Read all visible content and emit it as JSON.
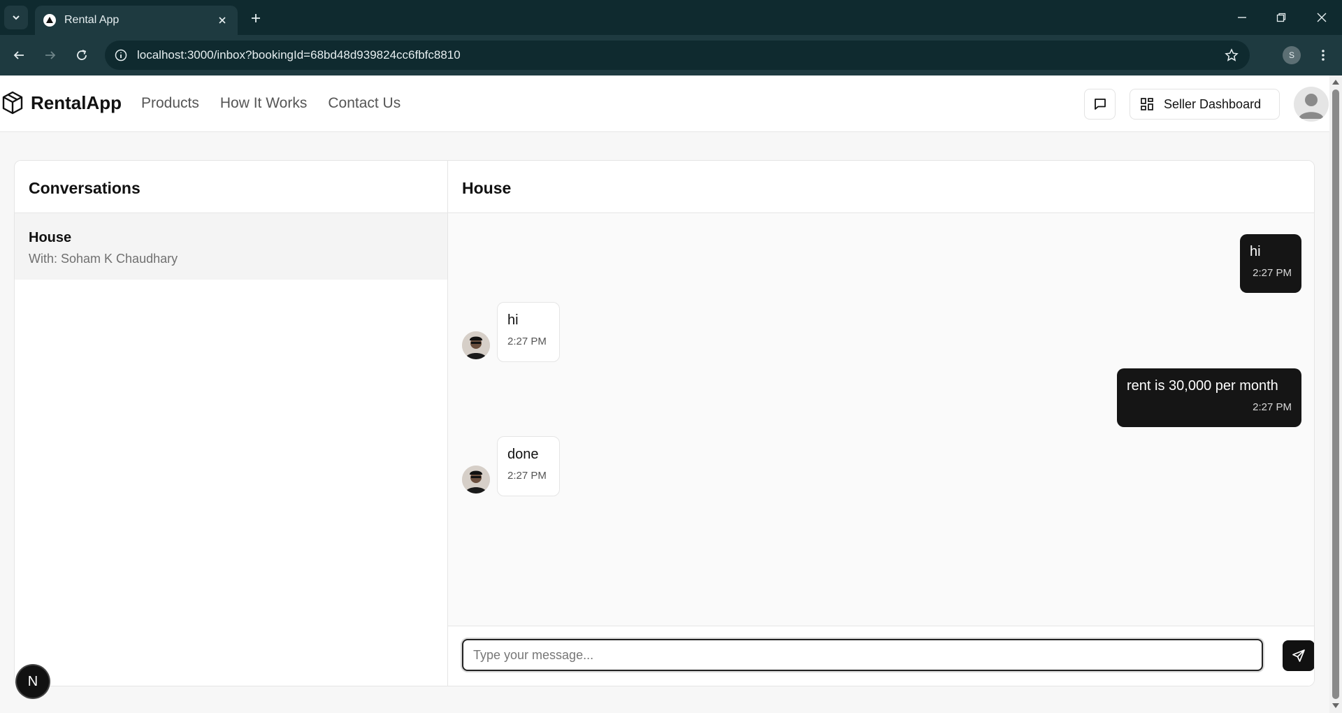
{
  "browser": {
    "tab_title": "Rental App",
    "url": "localhost:3000/inbox?bookingId=68bd48d939824cc6fbfc8810",
    "profile_initial": "S"
  },
  "header": {
    "brand": "RentalApp",
    "nav": [
      "Products",
      "How It Works",
      "Contact Us"
    ],
    "seller_dashboard_label": "Seller Dashboard"
  },
  "conversations": {
    "title": "Conversations",
    "items": [
      {
        "title": "House",
        "subtitle": "With: Soham K Chaudhary"
      }
    ]
  },
  "chat": {
    "title": "House",
    "messages": [
      {
        "direction": "out",
        "text": "hi",
        "time": "2:27 PM"
      },
      {
        "direction": "in",
        "text": "hi",
        "time": "2:27 PM"
      },
      {
        "direction": "out",
        "text": "rent is 30,000 per month",
        "time": "2:27 PM"
      },
      {
        "direction": "in",
        "text": "done",
        "time": "2:27 PM"
      }
    ],
    "input_placeholder": "Type your message...",
    "input_value": ""
  },
  "badge": {
    "label": "N"
  },
  "colors": {
    "chrome_dark": "#0f2a2f",
    "chrome_bar": "#1e3a40",
    "outgoing_bubble": "#151515",
    "accent": "#111111"
  }
}
